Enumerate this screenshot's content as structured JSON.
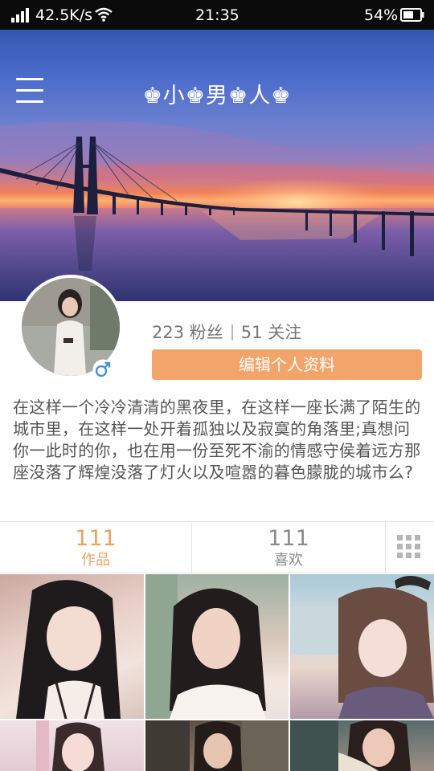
{
  "status_bar": {
    "net_speed": "42.5K/s",
    "time": "21:35",
    "battery": "54%"
  },
  "header": {
    "title": "♚小♚男♚人♚"
  },
  "profile": {
    "followers_count": "223",
    "followers_label": "粉丝",
    "following_count": "51",
    "following_label": "关注",
    "edit_button": "编辑个人资料",
    "gender_symbol": "♂",
    "bio": "在这样一个冷冷清清的黑夜里，在这样一座长满了陌生的城市里，在这样一处开着孤独以及寂寞的角落里;真想问你一此时的你，也在用一份至死不渝的情感守侯着远方那座没落了辉煌没落了灯火以及喧嚣的暮色朦胧的城市么?"
  },
  "tabs": {
    "works_count": "111",
    "works_label": "作品",
    "likes_count": "111",
    "likes_label": "喜欢"
  },
  "colors": {
    "accent": "#f3a46a",
    "gender_icon": "#4a90d9"
  },
  "icons": [
    "signal-icon",
    "wifi-icon",
    "battery-icon",
    "menu-icon",
    "male-icon",
    "grid-view-icon"
  ]
}
